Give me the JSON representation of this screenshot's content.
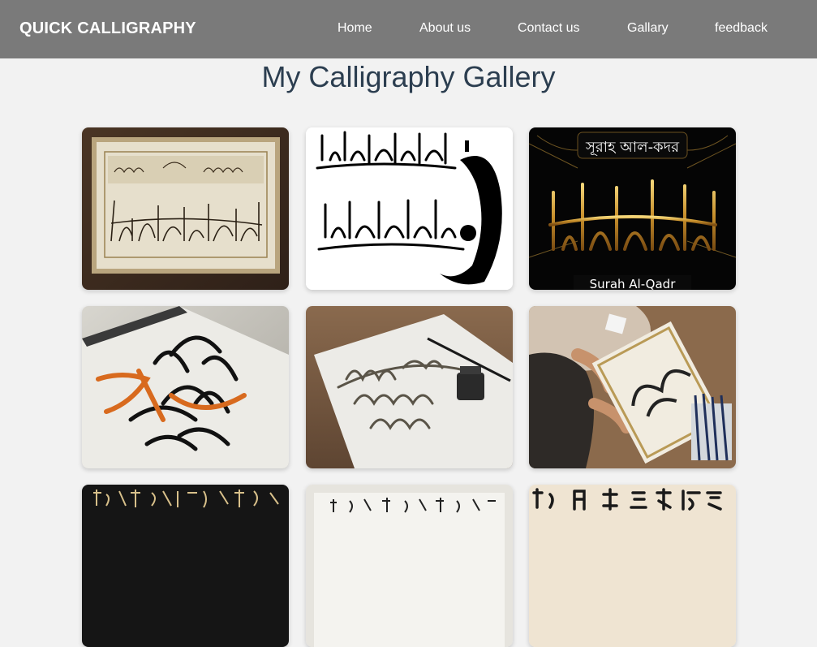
{
  "navbar": {
    "brand": "QUICK CALLIGRAPHY",
    "links": [
      "Home",
      "About us",
      "Contact us",
      "Gallary",
      "feedback"
    ],
    "background": "#7a7a7a"
  },
  "page": {
    "title": "My Calligraphy Gallery",
    "title_color": "#2c3e50",
    "background": "#f2f2f2"
  },
  "gallery": {
    "items": [
      {
        "image": "framed-arabic-calligraphy"
      },
      {
        "image": "arabic-calligraphy-black-on-white"
      },
      {
        "image": "surah-al-qadr-gold-calligraphy",
        "top_text": "সূরাহ আল-কদর",
        "bottom_text": "Surah Al-Qadr"
      },
      {
        "image": "gothic-calligraphy-with-orange-stroke"
      },
      {
        "image": "you-cant-take-the-sky-from-me-lettering"
      },
      {
        "image": "calligrapher-at-work"
      },
      {
        "image": "chinese-calligraphy-gold-on-black"
      },
      {
        "image": "chinese-calligraphy-ink-on-white"
      },
      {
        "image": "chinese-calligraphy-large-characters"
      }
    ]
  }
}
